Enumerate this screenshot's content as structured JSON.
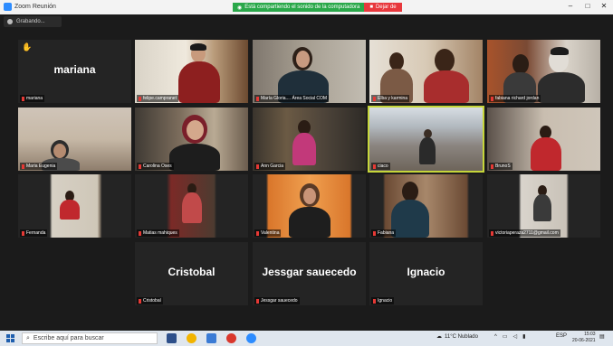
{
  "window": {
    "title": "Zoom Reunión"
  },
  "share_bar": {
    "sharing_text": "Está compartiendo el sonido de la computadora",
    "stop_label": "Dejar de"
  },
  "recording": {
    "label": "Grabando..."
  },
  "participants": [
    {
      "name": "mariana",
      "display": "mariana",
      "video": false,
      "hand_raised": true
    },
    {
      "name": "felipe.campranet",
      "video": true
    },
    {
      "name": "María Gloria.... Área Social COM",
      "video": true
    },
    {
      "name": "Elba y karmina",
      "video": true
    },
    {
      "name": "fabiana richard jordan",
      "video": true
    },
    {
      "name": "Maria Eugenia",
      "video": true
    },
    {
      "name": "Carolina Oses",
      "video": true
    },
    {
      "name": "Ann Garcia",
      "video": true
    },
    {
      "name": "ciaco",
      "video": true,
      "active": true
    },
    {
      "name": "BrunoS",
      "video": true
    },
    {
      "name": "Fernanda",
      "video": true
    },
    {
      "name": "Matias mahiques",
      "video": true
    },
    {
      "name": "Valentina",
      "video": true
    },
    {
      "name": "Fabiana",
      "video": true
    },
    {
      "name": "victoriaperaza2711@gmail.com",
      "video": true
    },
    {
      "name": "Cristobal",
      "display": "Cristobal",
      "video": false
    },
    {
      "name": "Jessgar sauecedo",
      "display": "Jessgar sauecedo",
      "video": false
    },
    {
      "name": "Ignacio",
      "display": "Ignacio",
      "video": false
    }
  ],
  "taskbar": {
    "search_placeholder": "Escribe aquí para buscar",
    "weather": "11°C Nublado",
    "language": "ESP",
    "time": "15:03",
    "date": "20-06-2021"
  },
  "colors": {
    "active_speaker": "#c6d63a",
    "mic_muted": "#e53935",
    "share_green": "#2aa84a",
    "stop_red": "#e8383d"
  }
}
